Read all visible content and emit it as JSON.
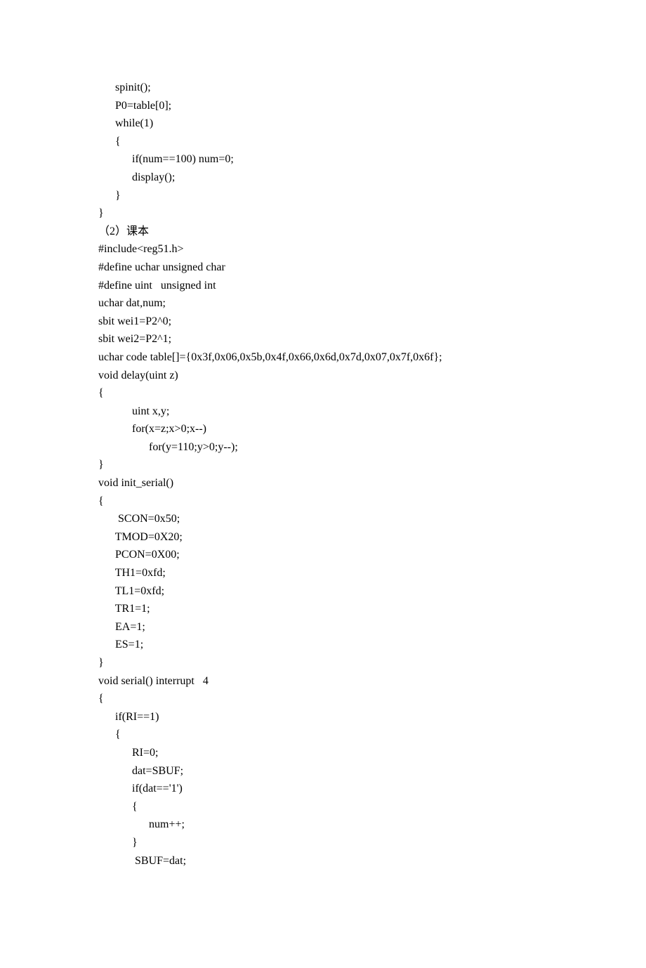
{
  "lines": [
    "      spinit();",
    "      P0=table[0];",
    "      while(1)",
    "      {",
    "            if(num==100) num=0;",
    "            display();",
    "      }",
    "}",
    "（2）课本",
    "#include<reg51.h>",
    "#define uchar unsigned char",
    "#define uint   unsigned int",
    "uchar dat,num;",
    "sbit wei1=P2^0;",
    "sbit wei2=P2^1;",
    "uchar code table[]={0x3f,0x06,0x5b,0x4f,0x66,0x6d,0x7d,0x07,0x7f,0x6f};",
    "void delay(uint z)",
    "{",
    "            uint x,y;",
    "            for(x=z;x>0;x--)",
    "                  for(y=110;y>0;y--);",
    "}",
    "void init_serial()",
    "{",
    "       SCON=0x50;",
    "      TMOD=0X20;",
    "      PCON=0X00;",
    "      TH1=0xfd;",
    "      TL1=0xfd;",
    "      TR1=1;",
    "      EA=1;",
    "      ES=1;",
    "}",
    "void serial() interrupt   4",
    "{",
    "      if(RI==1)",
    "      {",
    "            RI=0;",
    "            dat=SBUF;",
    "            if(dat=='1')",
    "            {",
    "                  num++;",
    "            }",
    "             SBUF=dat;"
  ]
}
